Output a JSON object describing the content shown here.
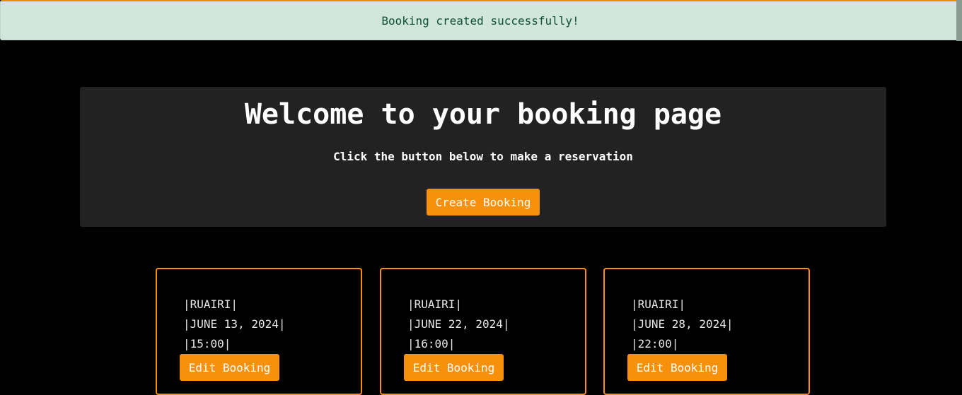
{
  "alert": {
    "message": "Booking created successfully!"
  },
  "hero": {
    "title": "Welcome to your booking page",
    "subtitle": "Click the button below to make a reservation",
    "create_label": "Create Booking"
  },
  "bookings": [
    {
      "name": "|RUAIRI|",
      "date": "|JUNE 13, 2024|",
      "time": "|15:00|",
      "edit_label": "Edit Booking"
    },
    {
      "name": "|RUAIRI|",
      "date": "|JUNE 22, 2024|",
      "time": "|16:00|",
      "edit_label": "Edit Booking"
    },
    {
      "name": "|RUAIRI|",
      "date": "|JUNE 28, 2024|",
      "time": "|22:00|",
      "edit_label": "Edit Booking"
    }
  ],
  "colors": {
    "accent": "#f7900b",
    "alert_bg": "#d1e7dd",
    "alert_text": "#0f5132",
    "panel_bg": "#222222",
    "page_bg": "#000000"
  }
}
